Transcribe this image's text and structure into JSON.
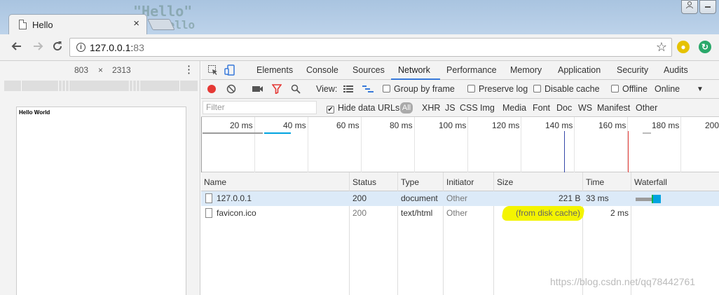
{
  "browser": {
    "tab_title": "Hello",
    "tab_close_icon": "×",
    "url_host": "127.0.0.1:",
    "url_port": "83",
    "window_buttons": [
      "user-icon",
      "minimize-icon"
    ],
    "background_code": [
      "\"Hello\"",
      "Hello"
    ]
  },
  "viewport": {
    "width": "803",
    "times": "×",
    "height": "2313",
    "page_text": "Hello World"
  },
  "devtools": {
    "tabs": [
      "Elements",
      "Console",
      "Sources",
      "Network",
      "Performance",
      "Memory",
      "Application",
      "Security",
      "Audits"
    ],
    "active_tab": "Network",
    "toolbar": {
      "view_label": "View:",
      "group_by_frame": "Group by frame",
      "preserve_log": "Preserve log",
      "disable_cache": "Disable cache",
      "offline": "Offline",
      "throttle": "Online"
    },
    "filter": {
      "placeholder": "Filter",
      "hide_data_urls": "Hide data URLs",
      "types": [
        "All",
        "XHR",
        "JS",
        "CSS",
        "Img",
        "Media",
        "Font",
        "Doc",
        "WS",
        "Manifest",
        "Other"
      ]
    },
    "overview_ticks": [
      "20 ms",
      "40 ms",
      "60 ms",
      "80 ms",
      "100 ms",
      "120 ms",
      "140 ms",
      "160 ms",
      "180 ms",
      "200"
    ],
    "columns": [
      "Name",
      "Status",
      "Type",
      "Initiator",
      "Size",
      "Time",
      "Waterfall"
    ],
    "requests": [
      {
        "name": "127.0.0.1",
        "status": "200",
        "type": "document",
        "initiator": "Other",
        "size": "221 B",
        "time": "33 ms"
      },
      {
        "name": "favicon.ico",
        "status": "200",
        "type": "text/html",
        "initiator": "Other",
        "size": "(from disk cache)",
        "time": "2 ms"
      }
    ]
  },
  "watermark": "https://blog.csdn.net/qq78442761",
  "colors": {
    "accent": "#3879d9",
    "highlight": "#f4f400",
    "record": "#e53935"
  }
}
